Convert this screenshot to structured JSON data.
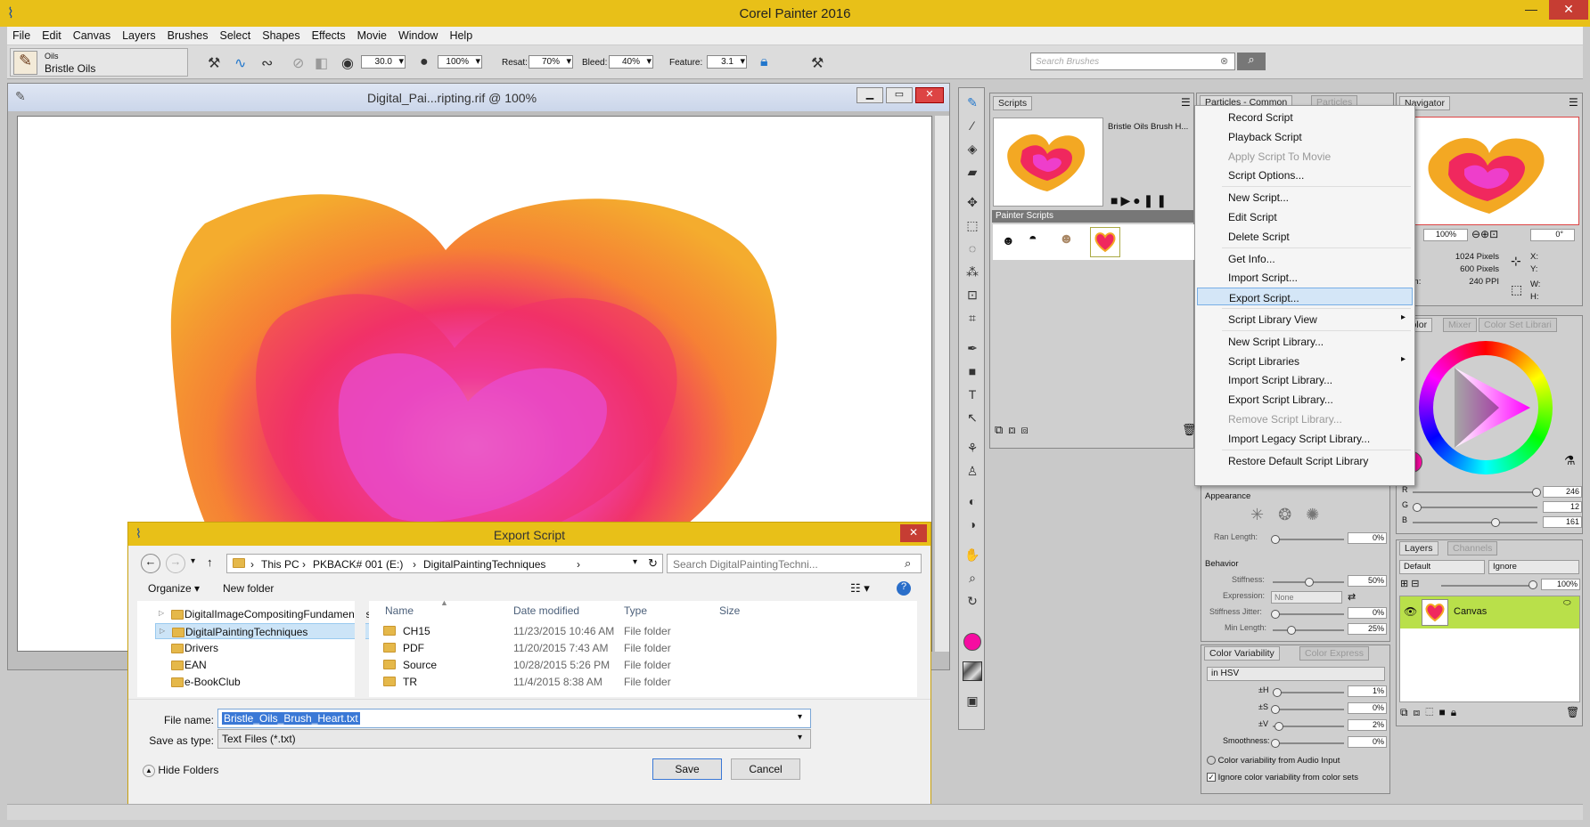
{
  "app": {
    "title": "Corel Painter 2016"
  },
  "menu": [
    "File",
    "Edit",
    "Canvas",
    "Layers",
    "Brushes",
    "Select",
    "Shapes",
    "Effects",
    "Movie",
    "Window",
    "Help"
  ],
  "property_bar": {
    "brush_category": "Oils",
    "brush_variant": "Bristle Oils",
    "size": "30.0",
    "opacity": "100%",
    "resat_label": "Resat:",
    "resat": "70%",
    "bleed_label": "Bleed:",
    "bleed": "40%",
    "feature_label": "Feature:",
    "feature": "3.1",
    "search_placeholder": "Search Brushes"
  },
  "document": {
    "title": "Digital_Pai...ripting.rif @ 100%"
  },
  "scripts_panel": {
    "tab": "Scripts",
    "script_name": "Bristle Oils Brush H...",
    "library_label": "Painter Scripts"
  },
  "particles_panel": {
    "tab_active": "Particles - Common",
    "tab_inactive": "Particles"
  },
  "navigator": {
    "tab": "Navigator",
    "zoom": "100%",
    "rotation": "0°",
    "width_value": "1024 Pixels",
    "height_value": "600 Pixels",
    "resolution_value": "240 PPI",
    "width_label": "h:",
    "height_label": "ht:",
    "resolution_label": "lution:",
    "x_label": "X:",
    "y_label": "Y:",
    "w_label": "W:",
    "h_label": "H:"
  },
  "context_menu": {
    "items": [
      {
        "label": "Record Script",
        "disabled": false
      },
      {
        "label": "Playback Script",
        "disabled": false
      },
      {
        "label": "Apply Script To Movie",
        "disabled": true
      },
      {
        "label": "Script Options...",
        "disabled": false
      },
      {
        "label": "New Script...",
        "disabled": false
      },
      {
        "label": "Edit Script",
        "disabled": false
      },
      {
        "label": "Delete Script",
        "disabled": false
      },
      {
        "label": "Get Info...",
        "disabled": false
      },
      {
        "label": "Import Script...",
        "disabled": false
      },
      {
        "label": "Export Script...",
        "disabled": false,
        "highlighted": true
      },
      {
        "label": "Script Library View",
        "disabled": false,
        "submenu": true
      },
      {
        "label": "New Script Library...",
        "disabled": false
      },
      {
        "label": "Script Libraries",
        "disabled": false,
        "submenu": true
      },
      {
        "label": "Import Script Library...",
        "disabled": false
      },
      {
        "label": "Export Script Library...",
        "disabled": false
      },
      {
        "label": "Remove Script Library...",
        "disabled": true
      },
      {
        "label": "Import Legacy Script Library...",
        "disabled": false
      },
      {
        "label": "Restore Default Script Library",
        "disabled": false
      }
    ]
  },
  "color_panel": {
    "tabs": [
      "Color",
      "Mixer",
      "Color Set Librari"
    ],
    "r_label": "R",
    "g_label": "G",
    "b_label": "B",
    "r": "246",
    "g": "12",
    "b": "161",
    "accent": "#f60ca1"
  },
  "particles_settings": {
    "appearance_label": "Appearance",
    "ran_length_label": "Ran Length:",
    "ran_length": "0%",
    "behavior_label": "Behavior",
    "stiffness_label": "Stiffness:",
    "stiffness": "50%",
    "expression_label": "Expression:",
    "expression": "None",
    "stiffness_jitter_label": "Stiffness Jitter:",
    "stiffness_jitter": "0%",
    "min_length_label": "Min Length:",
    "min_length": "25%"
  },
  "color_variability": {
    "tab_active": "Color Variability",
    "tab_inactive": "Color Express",
    "mode": "in HSV",
    "h_label": "±H",
    "h": "1%",
    "s_label": "±S",
    "s": "0%",
    "v_label": "±V",
    "v": "2%",
    "smoothness_label": "Smoothness:",
    "smoothness": "0%",
    "audio_label": "Color variability from Audio Input",
    "ignore_label": "Ignore color variability from color sets"
  },
  "layers_panel": {
    "tabs": [
      "Layers",
      "Channels"
    ],
    "composite": "Default",
    "method": "Ignore",
    "opacity": "100%",
    "layer_name": "Canvas"
  },
  "export_dialog": {
    "title": "Export Script",
    "breadcrumb": [
      "This PC",
      "PKBACK# 001 (E:)",
      "DigitalPaintingTechniques"
    ],
    "search_placeholder": "Search DigitalPaintingTechni...",
    "organize": "Organize",
    "new_folder": "New folder",
    "tree": [
      "DigitalImageCompositingFundamentals",
      "DigitalPaintingTechniques",
      "Drivers",
      "EAN",
      "e-BookClub"
    ],
    "columns": [
      "Name",
      "Date modified",
      "Type",
      "Size"
    ],
    "files": [
      {
        "name": "CH15",
        "date": "11/23/2015 10:46 AM",
        "type": "File folder"
      },
      {
        "name": "PDF",
        "date": "11/20/2015 7:43 AM",
        "type": "File folder"
      },
      {
        "name": "Source",
        "date": "10/28/2015 5:26 PM",
        "type": "File folder"
      },
      {
        "name": "TR",
        "date": "11/4/2015 8:38 AM",
        "type": "File folder"
      }
    ],
    "file_name_label": "File name:",
    "file_name": "Bristle_Oils_Brush_Heart.txt",
    "save_type_label": "Save as type:",
    "save_type": "Text Files (*.txt)",
    "hide_folders": "Hide Folders",
    "save": "Save",
    "cancel": "Cancel"
  }
}
